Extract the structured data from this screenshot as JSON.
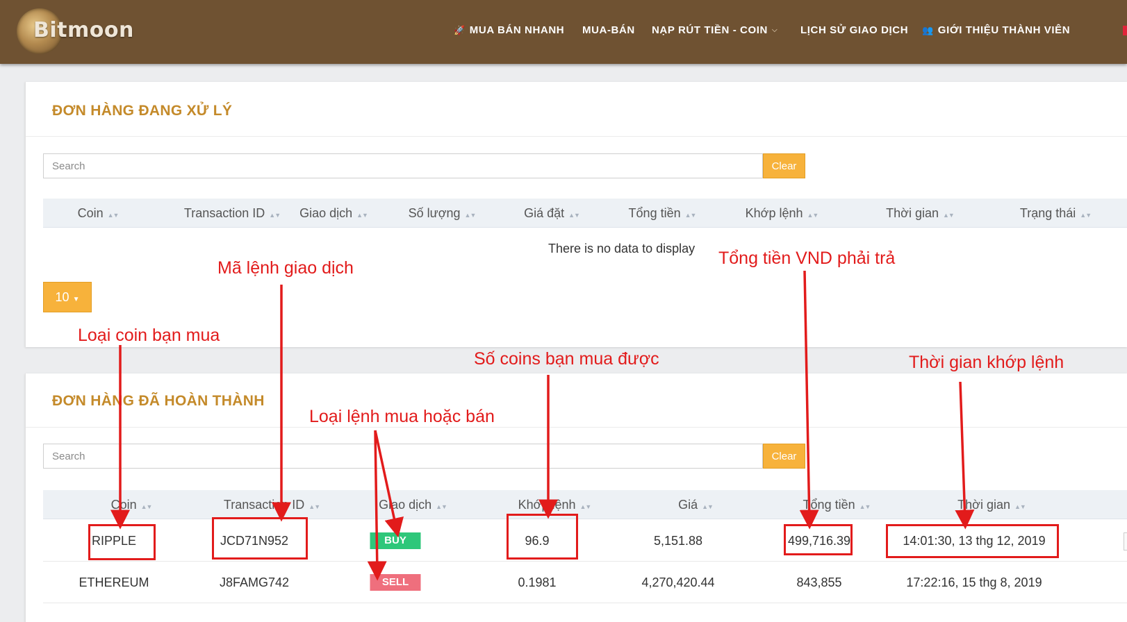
{
  "brand": {
    "name": "Bitmoon"
  },
  "nav": {
    "items": [
      {
        "label": "MUA BÁN NHANH",
        "icon": "rocket-icon"
      },
      {
        "label": "MUA-BÁN"
      },
      {
        "label": "NẠP RÚT TIỀN - COIN",
        "has_caret": true
      },
      {
        "label": "LỊCH SỬ GIAO DỊCH"
      },
      {
        "label": "GIỚI THIỆU THÀNH VIÊN",
        "icon": "user-plus-icon"
      }
    ]
  },
  "pending": {
    "title": "ĐƠN HÀNG ĐANG XỬ LÝ",
    "search_placeholder": "Search",
    "clear_label": "Clear",
    "columns": [
      "Coin",
      "Transaction ID",
      "Giao dịch",
      "Số lượng",
      "Giá đặt",
      "Tổng tiền",
      "Khớp lệnh",
      "Thời gian",
      "Trạng thái"
    ],
    "empty_text": "There is no data to display",
    "page_size": "10"
  },
  "completed": {
    "title": "ĐƠN HÀNG ĐÃ HOÀN THÀNH",
    "search_placeholder": "Search",
    "clear_label": "Clear",
    "columns": [
      "Coin",
      "Transaction ID",
      "Giao dịch",
      "Khớp lệnh",
      "Giá",
      "Tổng tiền",
      "Thời gian"
    ],
    "rows": [
      {
        "coin": "RIPPLE",
        "id": "JCD71N952",
        "side": "BUY",
        "matched": "96.9",
        "price": "5,151.88",
        "total": "499,716.39",
        "time": "14:01:30, 13 thg 12, 2019"
      },
      {
        "coin": "ETHEREUM",
        "id": "J8FAMG742",
        "side": "SELL",
        "matched": "0.1981",
        "price": "4,270,420.44",
        "total": "843,855",
        "time": "17:22:16, 15 thg 8, 2019"
      }
    ]
  },
  "annotations": {
    "ma_lenh": "Mã lệnh giao dịch",
    "tong_tien_vnd": "Tổng tiền VND phải trả",
    "loai_coin": "Loại coin bạn mua",
    "so_coins": "Số coins bạn mua được",
    "thoi_gian_khop": "Thời gian khớp lệnh",
    "loai_lenh": "Loại lệnh mua hoặc bán"
  },
  "colors": {
    "navbar": "#6f5232",
    "accent": "#f7b23b",
    "title": "#c48a2a",
    "buy": "#2ec77a",
    "sell": "#ef6f7d",
    "annotation": "#e21b1b"
  }
}
